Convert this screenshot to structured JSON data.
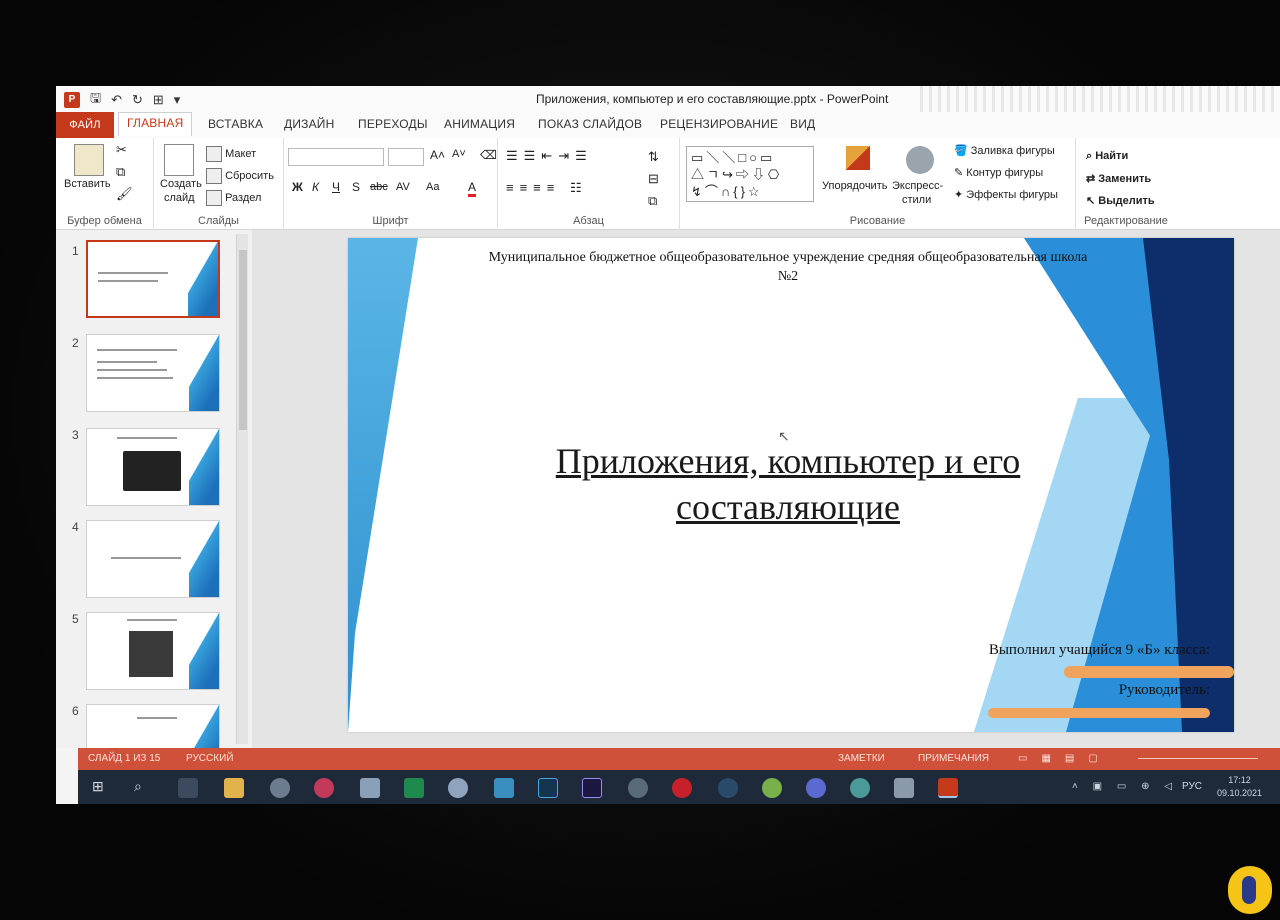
{
  "window": {
    "title": "Приложения, компьютер и его составляющие.pptx - PowerPoint"
  },
  "tabs": [
    "ФАЙЛ",
    "ГЛАВНАЯ",
    "ВСТАВКА",
    "ДИЗАЙН",
    "ПЕРЕХОДЫ",
    "АНИМАЦИЯ",
    "ПОКАЗ СЛАЙДОВ",
    "РЕЦЕНЗИРОВАНИЕ",
    "ВИД"
  ],
  "ribbon": {
    "clipboard": {
      "paste": "Вставить",
      "label": "Буфер обмена"
    },
    "slides": {
      "create_1": "Создать",
      "create_2": "слайд",
      "layout": "Макет",
      "reset": "Сбросить",
      "section": "Раздел",
      "label": "Слайды"
    },
    "font": {
      "label": "Шрифт",
      "bold": "Ж",
      "italic": "К",
      "underline": "Ч",
      "shadow": "S",
      "strike": "abc",
      "spacing": "AV",
      "case": "Aa",
      "color": "A"
    },
    "paragraph": {
      "label": "Абзац"
    },
    "drawing": {
      "arrange": "Упорядочить",
      "quick_1": "Экспресс-",
      "quick_2": "стили",
      "fill": "Заливка фигуры",
      "outline": "Контур фигуры",
      "effects": "Эффекты фигуры",
      "label": "Рисование"
    },
    "editing": {
      "find": "Найти",
      "replace": "Заменить",
      "select": "Выделить",
      "label": "Редактирование"
    }
  },
  "slide_panel": {
    "numbers": [
      "1",
      "2",
      "3",
      "4",
      "5",
      "6"
    ]
  },
  "slide": {
    "school_line1": "Муниципальное бюджетное общеобразовательное учреждение средняя общеобразовательная школа",
    "school_line2": "№2",
    "title_line1": "Приложения, компьютер и его",
    "title_line2": "составляющие",
    "author": "Выполнил учащийся 9 «Б» класса:",
    "leader": "Руководитель:"
  },
  "status": {
    "slide": "СЛАЙД 1 ИЗ 15",
    "lang": "РУССКИЙ",
    "notes": "ЗАМЕТКИ",
    "comments": "ПРИМЕЧАНИЯ"
  },
  "taskbar": {
    "lang": "РУС",
    "time": "17:12",
    "date": "09.10.2021"
  },
  "colors": {
    "accent": "#c5391b",
    "status_bar": "#d0513a",
    "slide_blue": "#2a8fd8",
    "slide_dark_blue": "#0d2d6b"
  }
}
